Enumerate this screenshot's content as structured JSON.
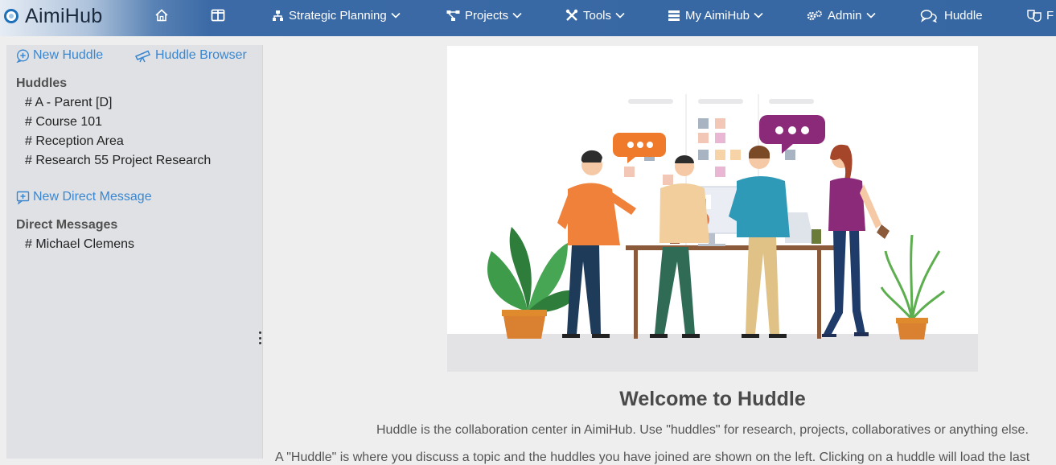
{
  "app": {
    "title": "AimiHub"
  },
  "nav": {
    "items": [
      {
        "label": "Strategic Planning",
        "icon": "org-chart-icon"
      },
      {
        "label": "Projects",
        "icon": "network-icon"
      },
      {
        "label": "Tools",
        "icon": "tools-icon"
      },
      {
        "label": "My AimiHub",
        "icon": "list-icon"
      },
      {
        "label": "Admin",
        "icon": "gears-icon"
      },
      {
        "label": "Huddle",
        "icon": "chat-bubbles-icon"
      },
      {
        "label": "F",
        "icon": "masks-icon"
      }
    ]
  },
  "sidebar": {
    "new_huddle": "New Huddle",
    "huddle_browser": "Huddle Browser",
    "huddles_heading": "Huddles",
    "huddles": [
      "# A - Parent [D]",
      "# Course 101",
      "# Reception Area",
      "# Research 55 Project Research"
    ],
    "new_direct_message": "New Direct Message",
    "direct_messages_heading": "Direct Messages",
    "direct_messages": [
      "# Michael Clemens"
    ]
  },
  "main": {
    "title": "Welcome to Huddle",
    "subtitle": "Huddle is the collaboration center in AimiHub. Use \"huddles\" for research, projects, collaboratives or anything else.",
    "description": "A \"Huddle\" is where you discuss a topic and the huddles you have joined are shown on the left. Clicking on a huddle will load the last"
  },
  "colors": {
    "nav_blue": "#3667a3",
    "link_blue": "#3a87d1",
    "sidebar_bg": "#dfe1e4",
    "page_bg": "#eeeeee"
  }
}
